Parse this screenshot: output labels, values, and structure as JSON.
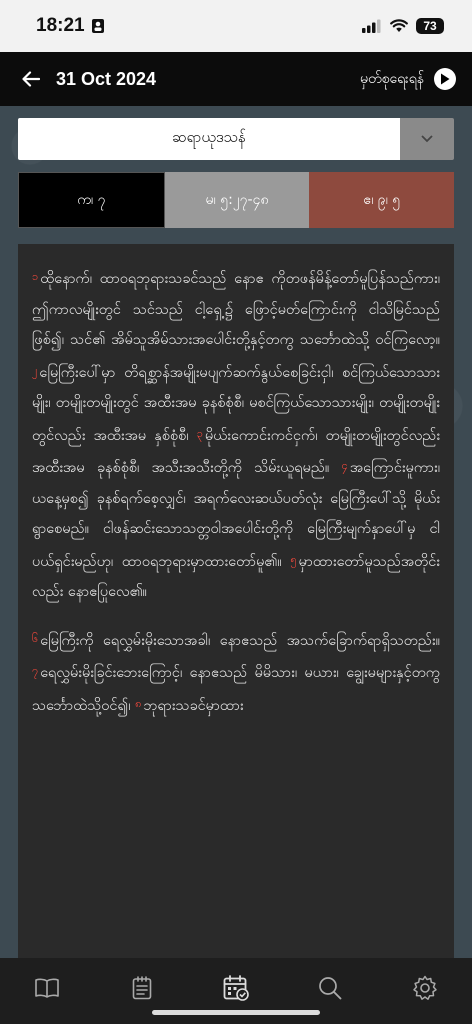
{
  "status_bar": {
    "time": "18:21",
    "battery": "73"
  },
  "header": {
    "date": "31 Oct 2024",
    "link_label": "မှတ်စုရေးရန်"
  },
  "dropdown": {
    "selected": "ဆရာယုဒသန်"
  },
  "reference": {
    "chapter": "က၊ ၇",
    "range": "မ၊ ၅:၂၇-၄၈",
    "total": "ဧ၊ ၉၊ ၅"
  },
  "paragraphs": [
    {
      "verses": [
        {
          "num": "၁",
          "text": "ထိုနောက်၊ ထာဝရဘုရားသခင်သည် နောဧ ကိုတဖန်မိန့်တော်မူပြန်သည်ကား၊ ဤကာလမျိုးတွင် သင်သည် ငါ့ရှေ့၌ ဖြောင့်မတ်ကြောင်းကို ငါသိမြင်သည်ဖြစ်၍၊ သင်၏ အိမ်သူအိမ်သားအပေါင်းတို့နှင့်တကွ သင်္ဘောထဲသို့ ဝင်ကြလော့။ "
        },
        {
          "num": "၂",
          "text": "မြေကြီးပေါ်မှာ တိရစ္ဆာန်အမျိုးမပျက်ဆက်နွယ်စေခြင်းငှါ၊ စင်ကြယ်သောသားမျိုး၊ တမျိုးတမျိုးတွင် အထီးအမ ခုနစ်စုံစီ၊ မစင်ကြယ်သောသားမျိုး၊ တမျိုးတမျိုးတွင်လည်း အထီးအမ နှစ်စုံစီ၊ "
        },
        {
          "num": "၃",
          "text": "မိုယ်းကောင်းကင်ငှက်၊ တမျိုးတမျိုးတွင်လည်း အထီးအမ ခုနစ်စုံစီ၊ အသီးအသီးတို့ကို သိမ်းယူရမည်။ "
        },
        {
          "num": "၄",
          "text": "အကြောင်းမူကား၊ ယနေ့မှစ၍ ခုနစ်ရက်စေ့လျှင်၊ အရက်လေးဆယ်ပတ်လုံး မြေကြီးပေါ်သို့ မိုယ်းရွာစေမည်။ ငါဖန်ဆင်းသောသတ္တဝါအပေါင်းတို့ကို မြေကြီးမျက်နှာပေါ်မှ ငါပယ်ရှင်းမည်ဟု၊ ထာဝရဘုရားမှာထားတော်မူ၏။ "
        },
        {
          "num": "၅",
          "text": "မှာထားတော်မူသည်အတိုင်းလည်း နောဧပြုလေ၏။"
        }
      ]
    },
    {
      "verses": [
        {
          "num": "၆",
          "text": "မြေကြီးကို ရေလွှမ်းမိုးသောအခါ၊ နောဧသည် အသက်ခြောက်ရာရှိသတည်း။ "
        },
        {
          "num": "၇",
          "text": "ရေလွှမ်းမိုးခြင်းဘေးကြောင့်၊ နောဧသည် မိမိသား၊ မယား၊ ချွေးမများနှင့်တကွ သင်္ဘောထဲသို့ဝင်၍၊ "
        },
        {
          "num": "၈",
          "text": "ဘုရားသခင်မှာထား"
        }
      ]
    }
  ],
  "nav": {
    "items": [
      "book-icon",
      "notes-icon",
      "calendar-icon",
      "search-icon",
      "settings-icon"
    ]
  },
  "colors": {
    "verse_number": "#ff4a3d",
    "total_cell": "#8e4a3e",
    "range_cell": "#9a9a9a"
  }
}
